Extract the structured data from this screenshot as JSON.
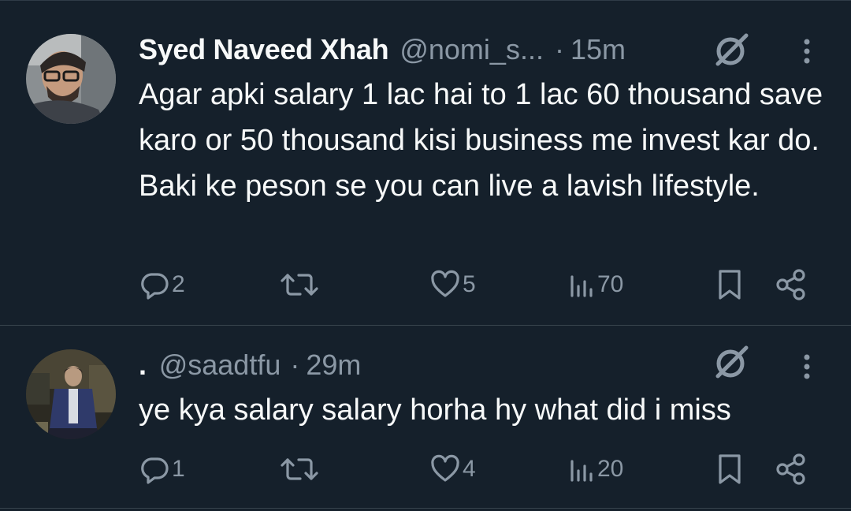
{
  "colors": {
    "background": "#15202b",
    "text_primary": "#f7f9f9",
    "text_secondary": "#8b98a5",
    "divider": "#38444d"
  },
  "tweets": [
    {
      "display_name": "Syed Naveed Xhah",
      "handle": "@nomi_s...",
      "separator": "·",
      "timestamp": "15m",
      "text": "Agar apki salary 1 lac hai to 1 lac 60 thousand save karo or 50 thousand kisi business me invest kar do. Baki ke peson se you can live a lavish lifestyle.",
      "reply_count": "2",
      "retweet_count": "",
      "like_count": "5",
      "view_count": "70",
      "icons": [
        "avatar",
        "grok-icon",
        "more-icon",
        "reply-icon",
        "retweet-icon",
        "like-icon",
        "views-icon",
        "bookmark-icon",
        "share-icon"
      ]
    },
    {
      "display_name": ".",
      "handle": "@saadtfu",
      "separator": "·",
      "timestamp": "29m",
      "text": "ye kya salary salary horha hy what did i miss",
      "reply_count": "1",
      "retweet_count": "",
      "like_count": "4",
      "view_count": "20",
      "icons": [
        "avatar",
        "grok-icon",
        "more-icon",
        "reply-icon",
        "retweet-icon",
        "like-icon",
        "views-icon",
        "bookmark-icon",
        "share-icon"
      ]
    }
  ]
}
